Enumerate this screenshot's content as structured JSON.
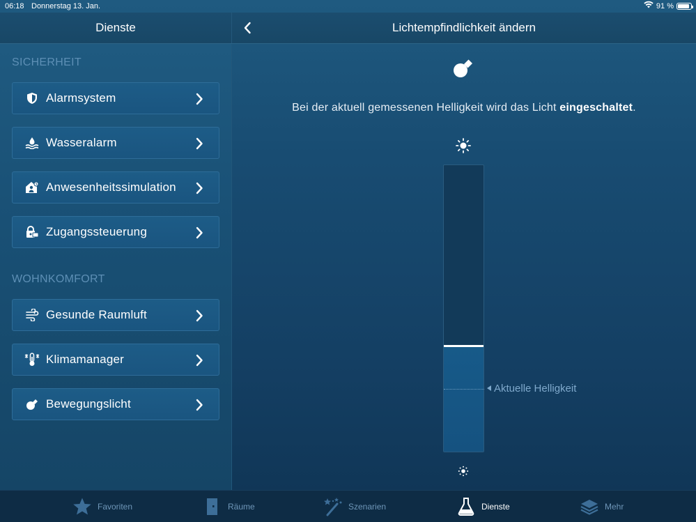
{
  "status_bar": {
    "time": "06:18",
    "date": "Donnerstag 13. Jan.",
    "battery": "91 %",
    "battery_level": 0.91
  },
  "header": {
    "left_title": "Dienste",
    "right_title": "Lichtempfindlichkeit ändern"
  },
  "sidebar": {
    "sections": [
      {
        "label": "SICHERHEIT"
      },
      {
        "label": "WOHNKOMFORT"
      }
    ],
    "items": [
      {
        "label": "Alarmsystem",
        "icon": "shield-icon"
      },
      {
        "label": "Wasseralarm",
        "icon": "water-drop-icon"
      },
      {
        "label": "Anwesenheitssimulation",
        "icon": "house-person-icon"
      },
      {
        "label": "Zugangssteuerung",
        "icon": "lock-icon"
      },
      {
        "label": "Gesunde Raumluft",
        "icon": "air-icon"
      },
      {
        "label": "Klimamanager",
        "icon": "thermometer-icon"
      },
      {
        "label": "Bewegungslicht",
        "icon": "bulb-icon"
      }
    ]
  },
  "main": {
    "message_prefix": "Bei der aktuell gemessenen Helligkeit wird das Licht ",
    "message_bold": "eingeschaltet",
    "message_suffix": ".",
    "current_label": "Aktuelle Helligkeit",
    "threshold_level": 0.37,
    "current_level": 0.22
  },
  "tabbar": {
    "tabs": [
      {
        "label": "Favoriten",
        "icon": "star-icon",
        "active": false
      },
      {
        "label": "Räume",
        "icon": "door-icon",
        "active": false
      },
      {
        "label": "Szenarien",
        "icon": "magic-wand-icon",
        "active": false
      },
      {
        "label": "Dienste",
        "icon": "flask-icon",
        "active": true
      },
      {
        "label": "Mehr",
        "icon": "layers-icon",
        "active": false
      }
    ]
  },
  "colors": {
    "accent": "#1a5580",
    "section_label": "#5d8fb5",
    "tab_inactive": "#6e96b8"
  }
}
